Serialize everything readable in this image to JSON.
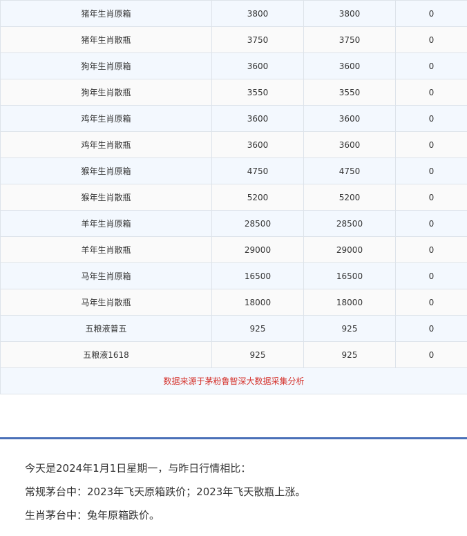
{
  "table": {
    "rows": [
      {
        "name": "猪年生肖原箱",
        "price_a": "3800",
        "price_b": "3800",
        "change": "0"
      },
      {
        "name": "猪年生肖散瓶",
        "price_a": "3750",
        "price_b": "3750",
        "change": "0"
      },
      {
        "name": "狗年生肖原箱",
        "price_a": "3600",
        "price_b": "3600",
        "change": "0"
      },
      {
        "name": "狗年生肖散瓶",
        "price_a": "3550",
        "price_b": "3550",
        "change": "0"
      },
      {
        "name": "鸡年生肖原箱",
        "price_a": "3600",
        "price_b": "3600",
        "change": "0"
      },
      {
        "name": "鸡年生肖散瓶",
        "price_a": "3600",
        "price_b": "3600",
        "change": "0"
      },
      {
        "name": "猴年生肖原箱",
        "price_a": "4750",
        "price_b": "4750",
        "change": "0"
      },
      {
        "name": "猴年生肖散瓶",
        "price_a": "5200",
        "price_b": "5200",
        "change": "0"
      },
      {
        "name": "羊年生肖原箱",
        "price_a": "28500",
        "price_b": "28500",
        "change": "0"
      },
      {
        "name": "羊年生肖散瓶",
        "price_a": "29000",
        "price_b": "29000",
        "change": "0"
      },
      {
        "name": "马年生肖原箱",
        "price_a": "16500",
        "price_b": "16500",
        "change": "0"
      },
      {
        "name": "马年生肖散瓶",
        "price_a": "18000",
        "price_b": "18000",
        "change": "0"
      },
      {
        "name": "五粮液普五",
        "price_a": "925",
        "price_b": "925",
        "change": "0"
      },
      {
        "name": "五粮液1618",
        "price_a": "925",
        "price_b": "925",
        "change": "0"
      }
    ],
    "source_note": "数据来源于茅粉鲁智深大数据采集分析"
  },
  "summary": {
    "line1": "今天是2024年1月1日星期一，与昨日行情相比：",
    "line2": "常规茅台中：2023年飞天原箱跌价；2023年飞天散瓶上涨。",
    "line3": "生肖茅台中：兔年原箱跌价。"
  },
  "colors": {
    "row_odd": "#f3f8fe",
    "row_even": "#fafafa",
    "border": "#dde3ea",
    "source_text": "#d4312b",
    "divider": "#4a70b8"
  }
}
